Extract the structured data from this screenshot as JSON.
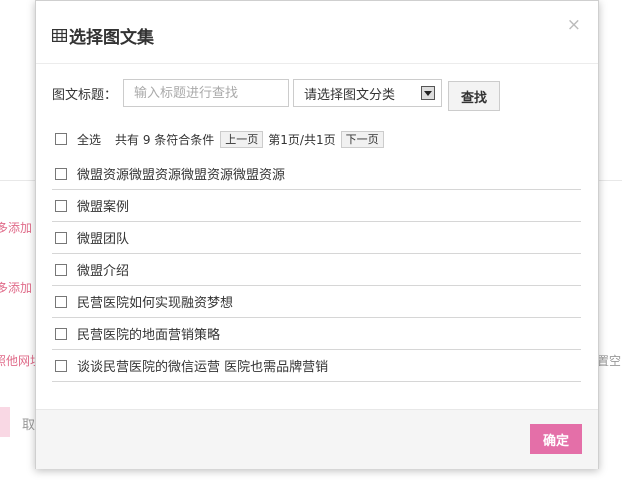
{
  "background": {
    "fragment_1": "多添加",
    "fragment_2": "多添加",
    "fragment_3": "照他网址",
    "fragment_4": "取",
    "fragment_5": "置空"
  },
  "dialog": {
    "title": "选择图文集",
    "close_label": "×",
    "search": {
      "label": "图文标题：",
      "placeholder": "输入标题进行查找",
      "value": "",
      "category_selected": "请选择图文分类",
      "find_label": "查找"
    },
    "toolbar": {
      "select_all_label": "全选",
      "count_text": "共有 9 条符合条件",
      "prev_label": "上一页",
      "page_info": "第1页/共1页",
      "next_label": "下一页"
    },
    "items": [
      {
        "title": "微盟资源微盟资源微盟资源微盟资源"
      },
      {
        "title": "微盟案例"
      },
      {
        "title": "微盟团队"
      },
      {
        "title": "微盟介绍"
      },
      {
        "title": "民营医院如何实现融资梦想"
      },
      {
        "title": "民营医院的地面营销策略"
      },
      {
        "title": "谈谈民营医院的微信运营 医院也需品牌营销"
      }
    ],
    "confirm_label": "确定"
  },
  "colors": {
    "accent": "#e46fa8",
    "background_link": "#e06c8a"
  }
}
